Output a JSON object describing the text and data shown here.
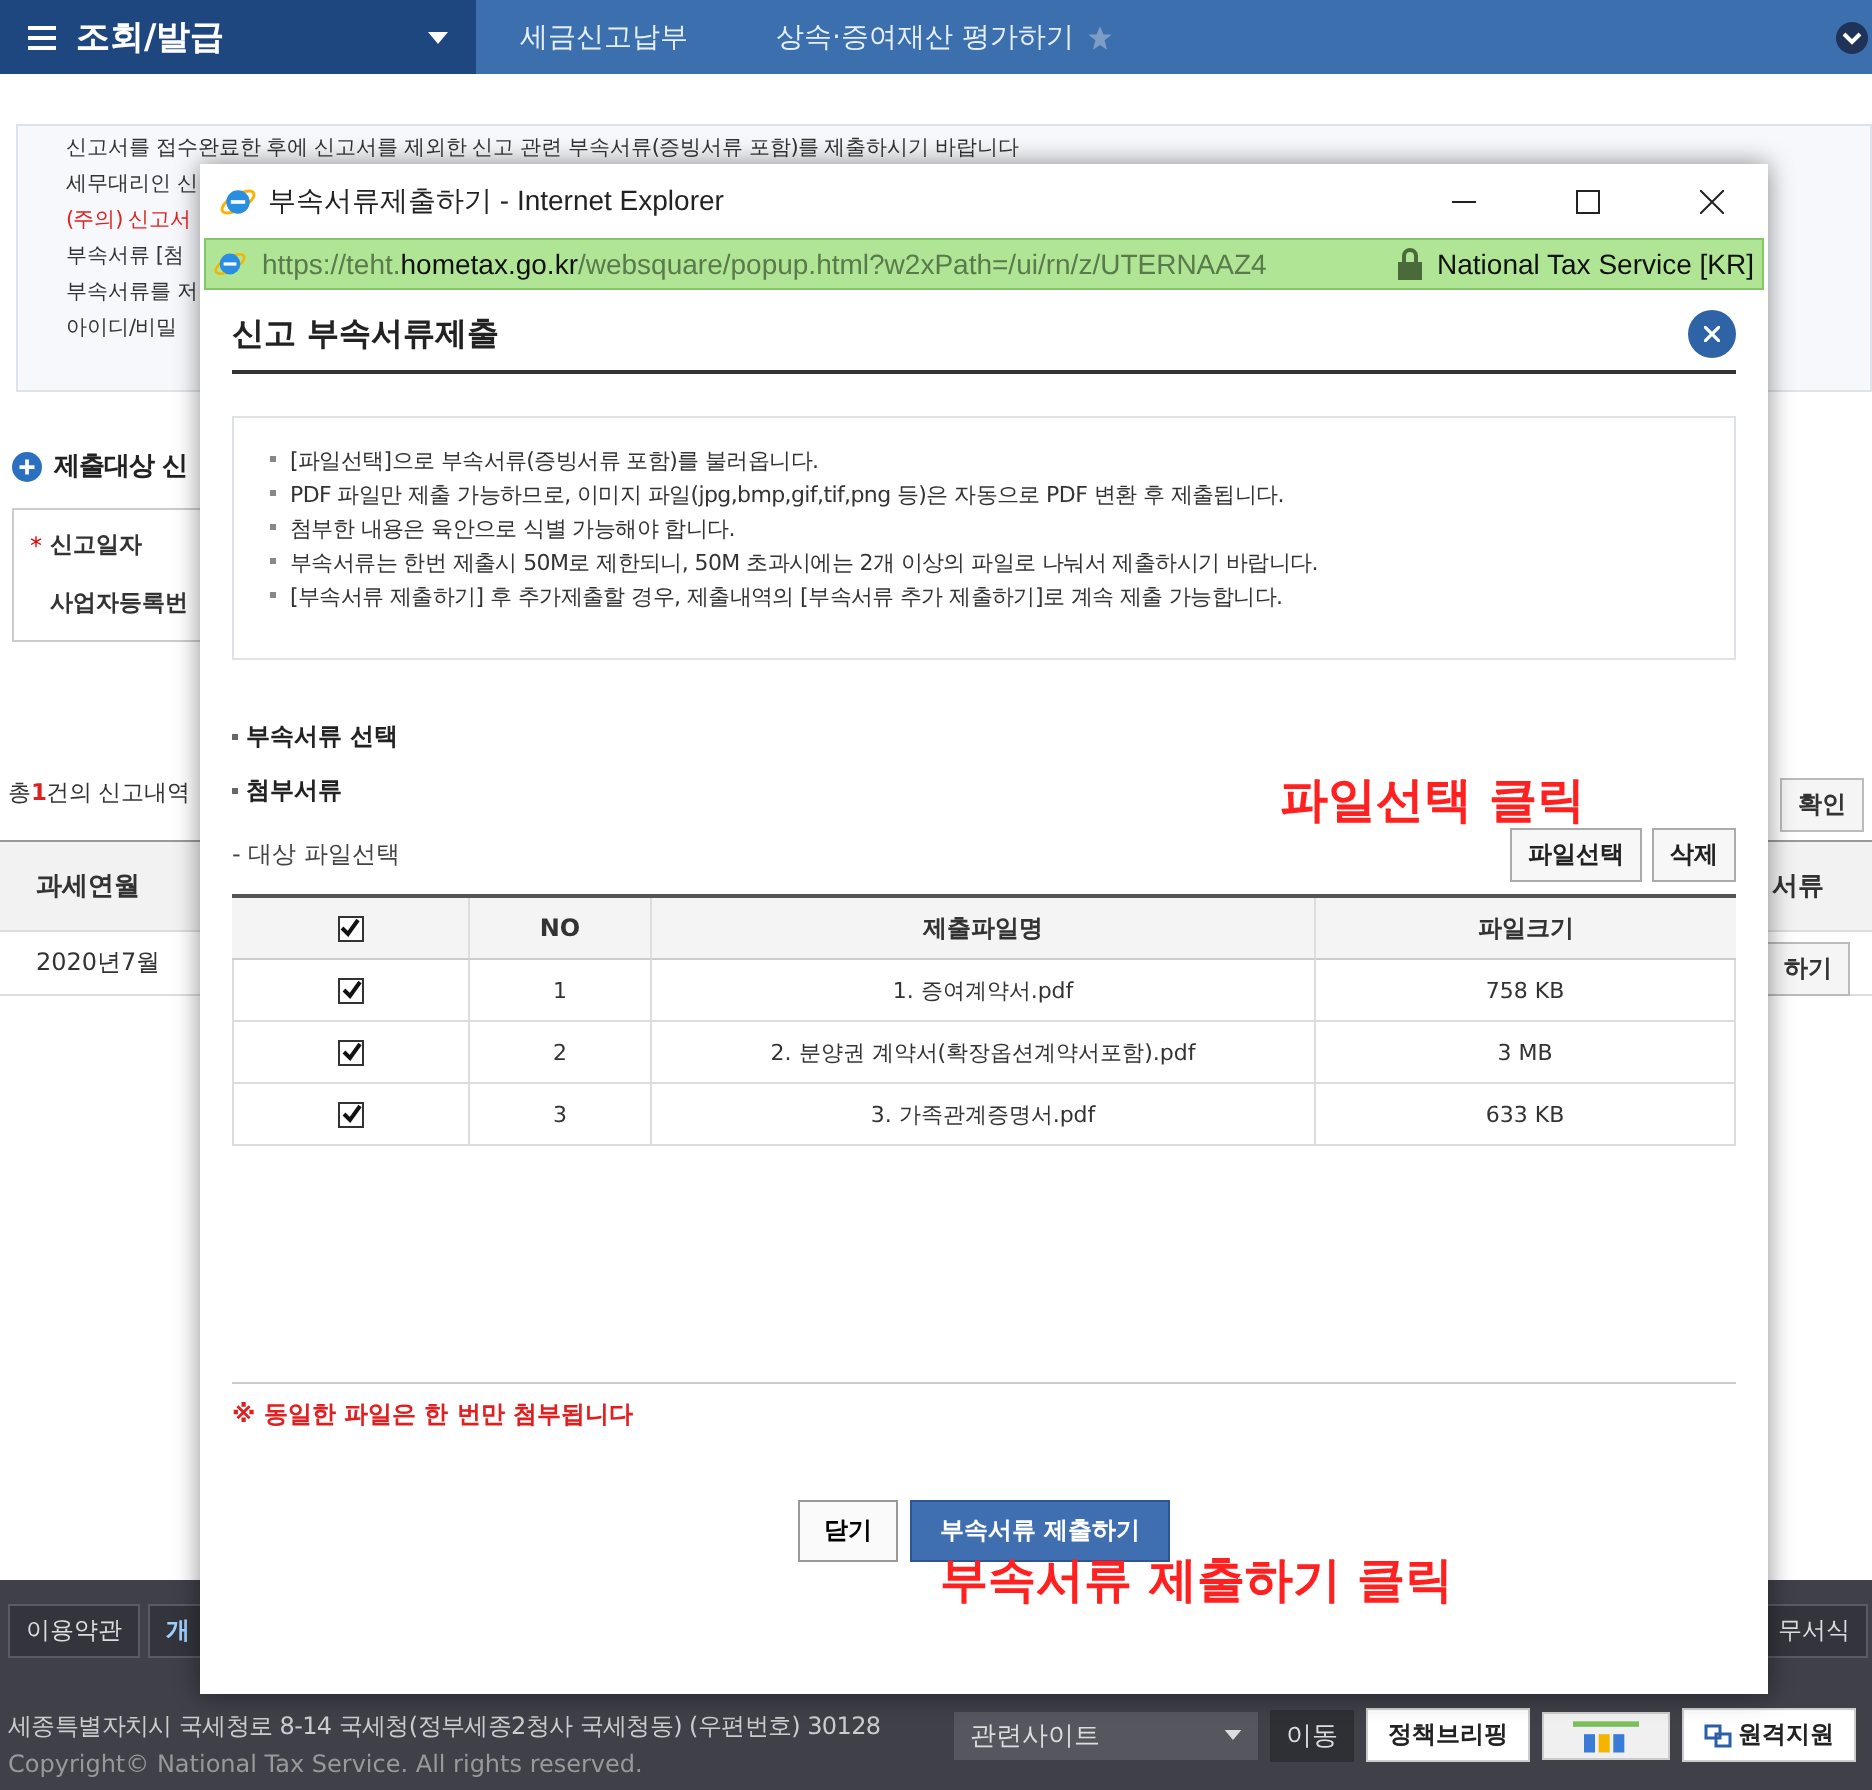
{
  "nav": {
    "menu_title": "조회/발급",
    "breadcrumbs": [
      "세금신고납부",
      "상속·증여재산 평가하기"
    ]
  },
  "notice": [
    {
      "text": "신고서를 접수완료한 후에 신고서를 제외한 신고 관련 부속서류(증빙서류 포함)를 제출하시기 바랍니다",
      "kind": "normal"
    },
    {
      "text": "세무대리인 신",
      "kind": "normal"
    },
    {
      "text": "(주의) 신고서",
      "kind": "warning"
    },
    {
      "text": "부속서류 [첨",
      "kind": "normal"
    },
    {
      "text": "부속서류를 저",
      "kind": "normal"
    },
    {
      "text": "아이디/비밀",
      "kind": "normal"
    }
  ],
  "section_title": "제출대상 신",
  "form": {
    "required_mark": "*",
    "date_label": "신고일자",
    "business_label": "사업자등록번"
  },
  "total": {
    "prefix": "총",
    "count": "1",
    "suffix": "건의 신고내역"
  },
  "confirm_button": "확인",
  "table": {
    "column_1": "과세연월",
    "column_right": "서류",
    "row": {
      "month": "2020년7월",
      "action_right": "하기"
    }
  },
  "footer": {
    "links": [
      "이용약관",
      "개"
    ],
    "right_link": "무서식",
    "address": "세종특별자치시 국세청로 8-14 국세청(정부세종2청사 국세청동) (우편번호) 30128",
    "copyright": "Copyright© National Tax Service. All rights reserved.",
    "site_select": "관련사이트",
    "go_button": "이동",
    "briefing_button": "정책브리핑",
    "remote_button": "원격지원"
  },
  "popup": {
    "window_title": "부속서류제출하기 - Internet Explorer",
    "url_prefix": "https://teht.",
    "url_domain": "hometax.go.kr",
    "url_path": "/websquare/popup.html?w2xPath=/ui/rn/z/UTERNAAZ4",
    "site_identity": "National Tax Service [KR]",
    "heading": "신고 부속서류제출",
    "guide": [
      "[파일선택]으로 부속서류(증빙서류 포함)를 불러옵니다.",
      "PDF 파일만 제출 가능하므로, 이미지 파일(jpg,bmp,gif,tif,png 등)은 자동으로 PDF 변환 후 제출됩니다.",
      "첨부한 내용은 육안으로 식별 가능해야 합니다.",
      "부속서류는 한번 제출시 50M로 제한되니, 50M 초과시에는 2개 이상의 파일로 나눠서 제출하시기 바랍니다.",
      "[부속서류 제출하기] 후 추가제출할 경우, 제출내역의 [부속서류 추가 제출하기]로 계속 제출 가능합니다."
    ],
    "section_select": "부속서류 선택",
    "section_attach": "첨부서류",
    "target_label": "- 대상 파일선택",
    "select_button": "파일선택",
    "delete_button": "삭제",
    "all_checked": true,
    "columns": [
      "NO",
      "제출파일명",
      "파일크기"
    ],
    "files": [
      {
        "no": "1",
        "name": "1. 증여계약서.pdf",
        "size": "758 KB",
        "checked": true
      },
      {
        "no": "2",
        "name": "2. 분양권 계약서(확장옵션계약서포함).pdf",
        "size": "3 MB",
        "checked": true
      },
      {
        "no": "3",
        "name": "3. 가족관계증명서.pdf",
        "size": "633 KB",
        "checked": true
      }
    ],
    "note": "※ 동일한 파일은 한 번만 첨부됩니다",
    "close_button": "닫기",
    "submit_button": "부속서류 제출하기"
  },
  "annotations": [
    "파일선택 클릭",
    "부속서류 제출하기 클릭"
  ]
}
